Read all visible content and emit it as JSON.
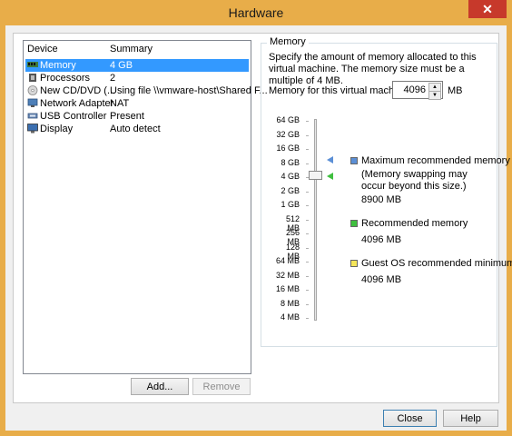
{
  "window": {
    "title": "Hardware",
    "close_glyph": "✕"
  },
  "device_list": {
    "col_device": "Device",
    "col_summary": "Summary",
    "rows": [
      {
        "device": "Memory",
        "summary": "4 GB",
        "icon": "memory-icon"
      },
      {
        "device": "Processors",
        "summary": "2",
        "icon": "processor-icon"
      },
      {
        "device": "New CD/DVD (...",
        "summary": "Using file \\\\vmware-host\\Shared F...",
        "icon": "cd-dvd-icon"
      },
      {
        "device": "Network Adapter",
        "summary": "NAT",
        "icon": "network-adapter-icon"
      },
      {
        "device": "USB Controller",
        "summary": "Present",
        "icon": "usb-controller-icon"
      },
      {
        "device": "Display",
        "summary": "Auto detect",
        "icon": "display-icon"
      }
    ],
    "add_label": "Add...",
    "remove_label": "Remove"
  },
  "memory": {
    "group_label": "Memory",
    "description": "Specify the amount of memory allocated to this virtual machine. The memory size must be a multiple of 4 MB.",
    "field_label": "Memory for this virtual machine:",
    "value": "4096",
    "unit": "MB",
    "ticks": [
      "64 GB",
      "32 GB",
      "16 GB",
      "8 GB",
      "4 GB",
      "2 GB",
      "1 GB",
      "512 MB",
      "256 MB",
      "128 MB",
      "64 MB",
      "32 MB",
      "16 MB",
      "8 MB",
      "4 MB"
    ],
    "max_title": "Maximum recommended memory",
    "max_note": "(Memory swapping may occur beyond this size.)",
    "max_value": "8900 MB",
    "rec_title": "Recommended memory",
    "rec_value": "4096 MB",
    "min_title": "Guest OS recommended minimum",
    "min_value": "4096 MB",
    "colors": {
      "max": "#5b8fd6",
      "rec": "#3fbf3f",
      "min": "#f5e65a",
      "selection": "#3399ff",
      "title_bar": "#e8ad49"
    }
  },
  "buttons": {
    "close_label": "Close",
    "help_label": "Help"
  }
}
